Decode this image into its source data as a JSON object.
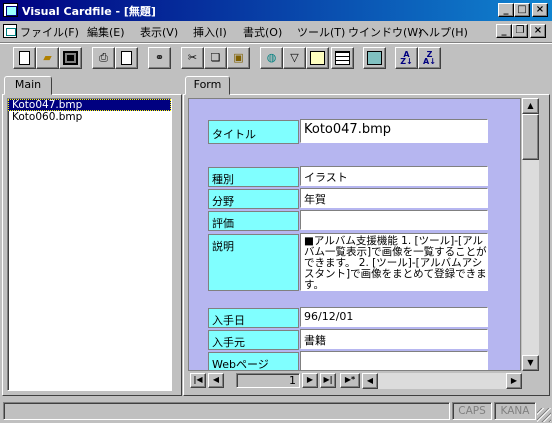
{
  "window": {
    "title": "Visual Cardfile - [無題]"
  },
  "menu": [
    "ファイル(F)",
    "編集(E)",
    "表示(V)",
    "挿入(I)",
    "書式(O)",
    "ツール(T)",
    "ウインドウ(W)",
    "ヘルプ(H)"
  ],
  "toolbar": [
    "new-icon",
    "open-icon",
    "save-icon",
    "print-icon",
    "print-preview-icon",
    "find-icon",
    "cut-icon",
    "copy-icon",
    "paste-icon",
    "web-icon",
    "filter-icon",
    "form-view-icon",
    "table-view-icon",
    "album-icon",
    "sort-ascending-icon",
    "sort-descending-icon"
  ],
  "left_tab": "Main",
  "files": [
    {
      "name": "Koto047.bmp",
      "selected": true
    },
    {
      "name": "Koto060.bmp",
      "selected": false
    }
  ],
  "right_tab": "Form",
  "form": {
    "title": {
      "label": "タイトル",
      "value": "Koto047.bmp"
    },
    "type": {
      "label": "種別",
      "value": "イラスト"
    },
    "field": {
      "label": "分野",
      "value": "年賀"
    },
    "rating": {
      "label": "評価",
      "value": ""
    },
    "description": {
      "label": "説明",
      "value": "■アルバム支援機能 1. [ツール]-[アルバム一覧表示]で画像を一覧することができます。 2. [ツール]-[アルバムアシスタント]で画像をまとめて登録できます。"
    },
    "acquired_date": {
      "label": "入手日",
      "value": "96/12/01"
    },
    "source": {
      "label": "入手元",
      "value": "書籍"
    },
    "webpage": {
      "label": "Webページ",
      "value": ""
    }
  },
  "record_number": "1",
  "status": {
    "caps": "CAPS",
    "kana": "KANA"
  }
}
